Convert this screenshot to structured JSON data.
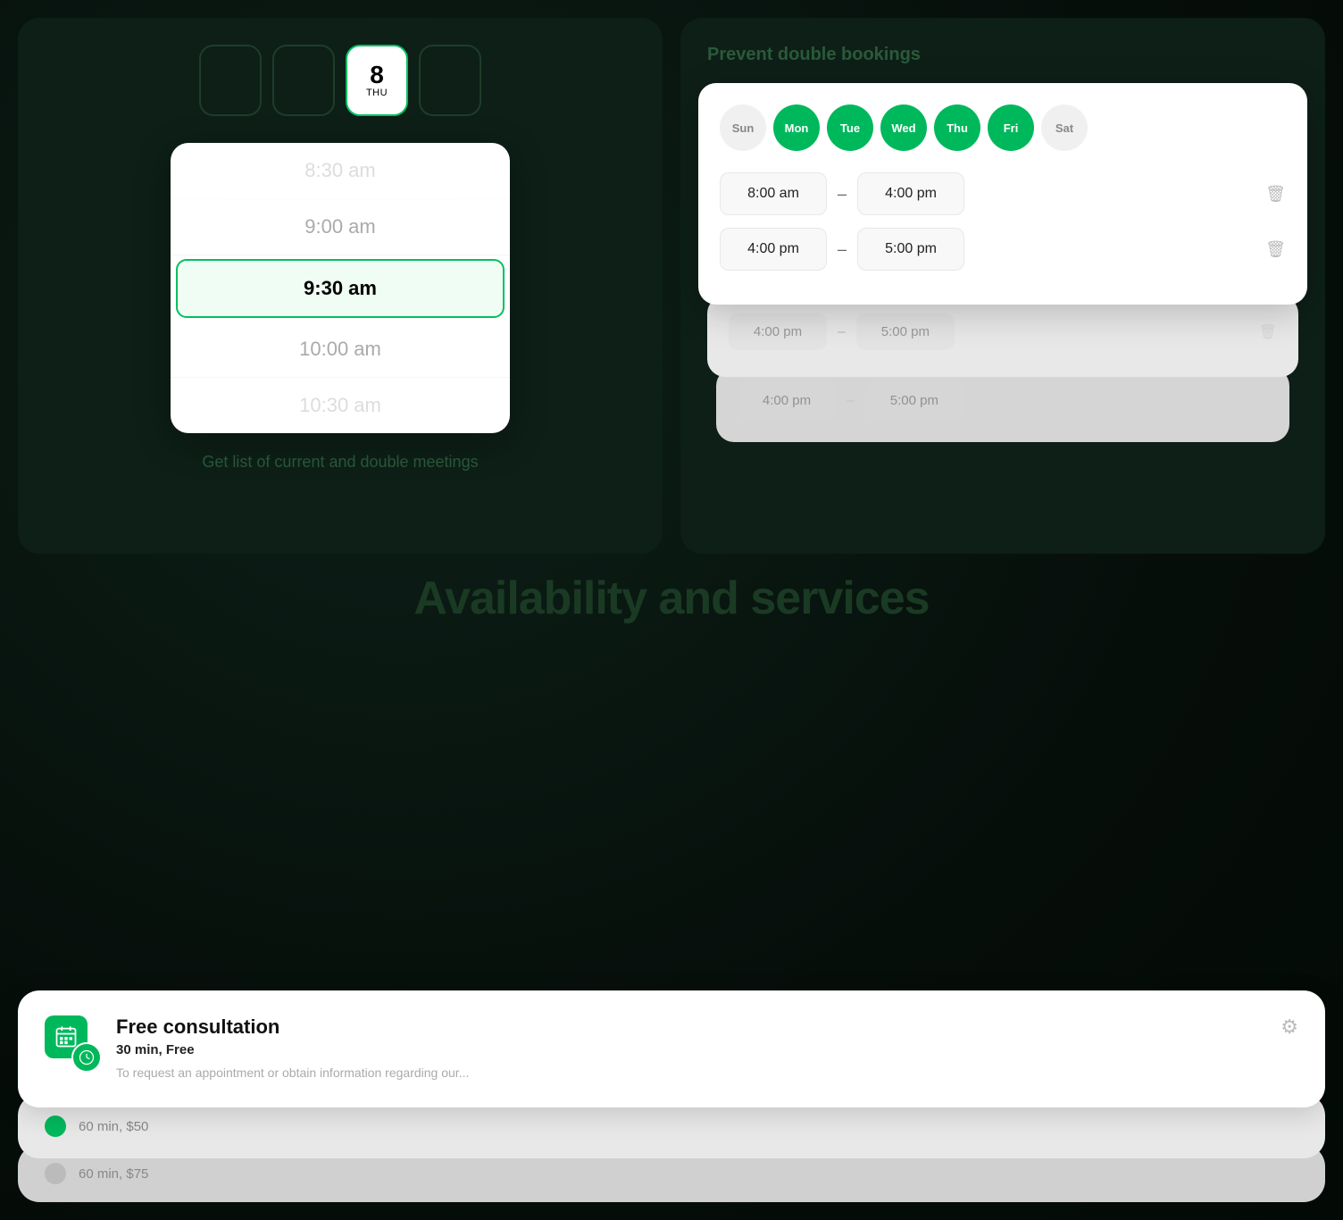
{
  "background": {
    "color": "#0a1a14"
  },
  "left_card": {
    "days": [
      {
        "id": "day-prev1",
        "num": "",
        "label": "",
        "active": false
      },
      {
        "id": "day-prev2",
        "num": "",
        "label": "",
        "active": false
      },
      {
        "id": "day-8",
        "num": "8",
        "label": "THU",
        "active": true
      },
      {
        "id": "day-next1",
        "num": "",
        "label": "",
        "active": false
      }
    ],
    "times": [
      {
        "id": "t-830",
        "label": "8:30 am",
        "selected": false,
        "faded": true
      },
      {
        "id": "t-900",
        "label": "9:00 am",
        "selected": false,
        "faded": false
      },
      {
        "id": "t-930",
        "label": "9:30 am",
        "selected": true,
        "faded": false
      },
      {
        "id": "t-1000",
        "label": "10:00 am",
        "selected": false,
        "faded": false
      },
      {
        "id": "t-1030",
        "label": "10:30 am",
        "selected": false,
        "faded": true
      }
    ],
    "subtitle": "Get list of current and\ndouble meetings"
  },
  "right_card": {
    "title": "Prevent double bookings",
    "days": [
      {
        "label": "Sun",
        "active": false
      },
      {
        "label": "Mon",
        "active": true
      },
      {
        "label": "Tue",
        "active": true
      },
      {
        "label": "Wed",
        "active": true
      },
      {
        "label": "Thu",
        "active": true
      },
      {
        "label": "Fri",
        "active": true
      },
      {
        "label": "Sat",
        "active": false
      }
    ],
    "time_ranges": [
      {
        "start": "8:00 am",
        "end": "4:00 pm"
      },
      {
        "start": "4:00 pm",
        "end": "5:00 pm"
      }
    ],
    "faded_ranges": [
      {
        "start": "4:00 pm",
        "end": "5:00 pm"
      },
      {
        "start": "4:00 pm",
        "end": "5:00 pm"
      }
    ]
  },
  "middle_text": "Availability and services",
  "service_card": {
    "title": "Free consultation",
    "meta": "30 min, Free",
    "description": "To request an appointment or obtain information regarding our...",
    "gear_label": "⚙"
  },
  "behind_cards": [
    {
      "label": "60 min, $50"
    },
    {
      "label": "60 min, $75"
    }
  ]
}
